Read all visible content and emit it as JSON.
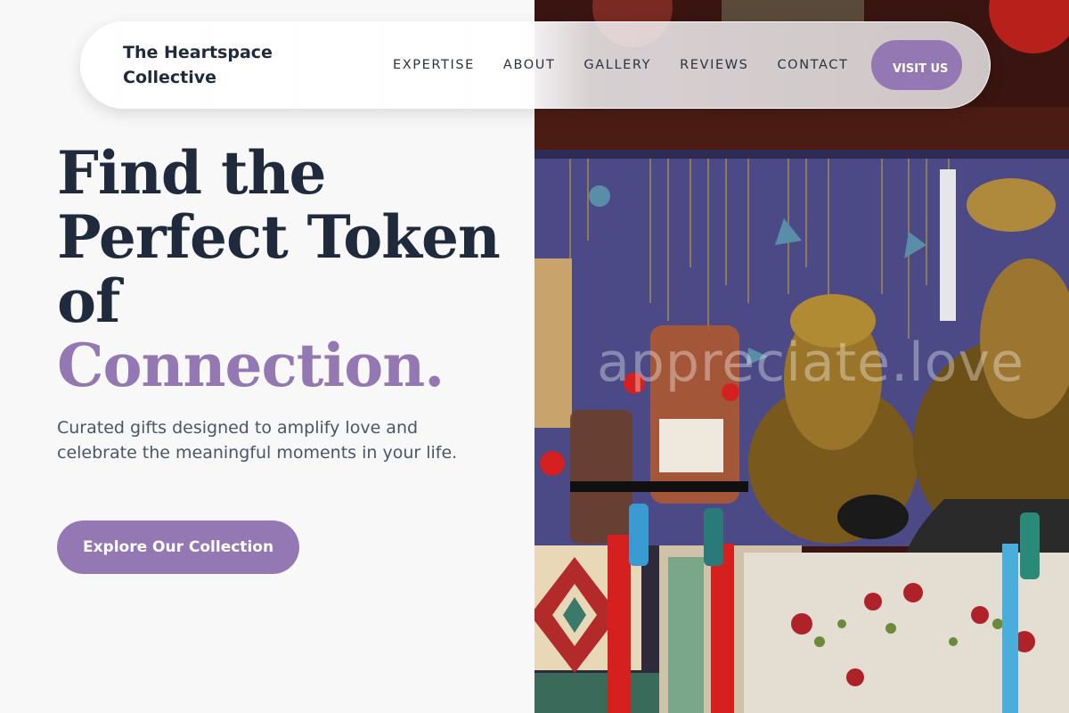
{
  "brand": {
    "name": "The Heartspace Collective"
  },
  "nav": {
    "links": [
      "EXPERTISE",
      "ABOUT",
      "GALLERY",
      "REVIEWS",
      "CONTACT"
    ],
    "cta_label": "VISIT US"
  },
  "hero": {
    "headline_main": "Find the Perfect Token of",
    "headline_accent": "Connection.",
    "subtext": "Curated gifts designed to amplify love and celebrate the meaningful moments in your life.",
    "cta_label": "Explore Our Collection",
    "image_watermark": "appreciate.love"
  },
  "colors": {
    "accent": "#9478b4",
    "heading": "#1f2a3d",
    "body_text": "#4b5563",
    "background": "#f8f8f8"
  }
}
